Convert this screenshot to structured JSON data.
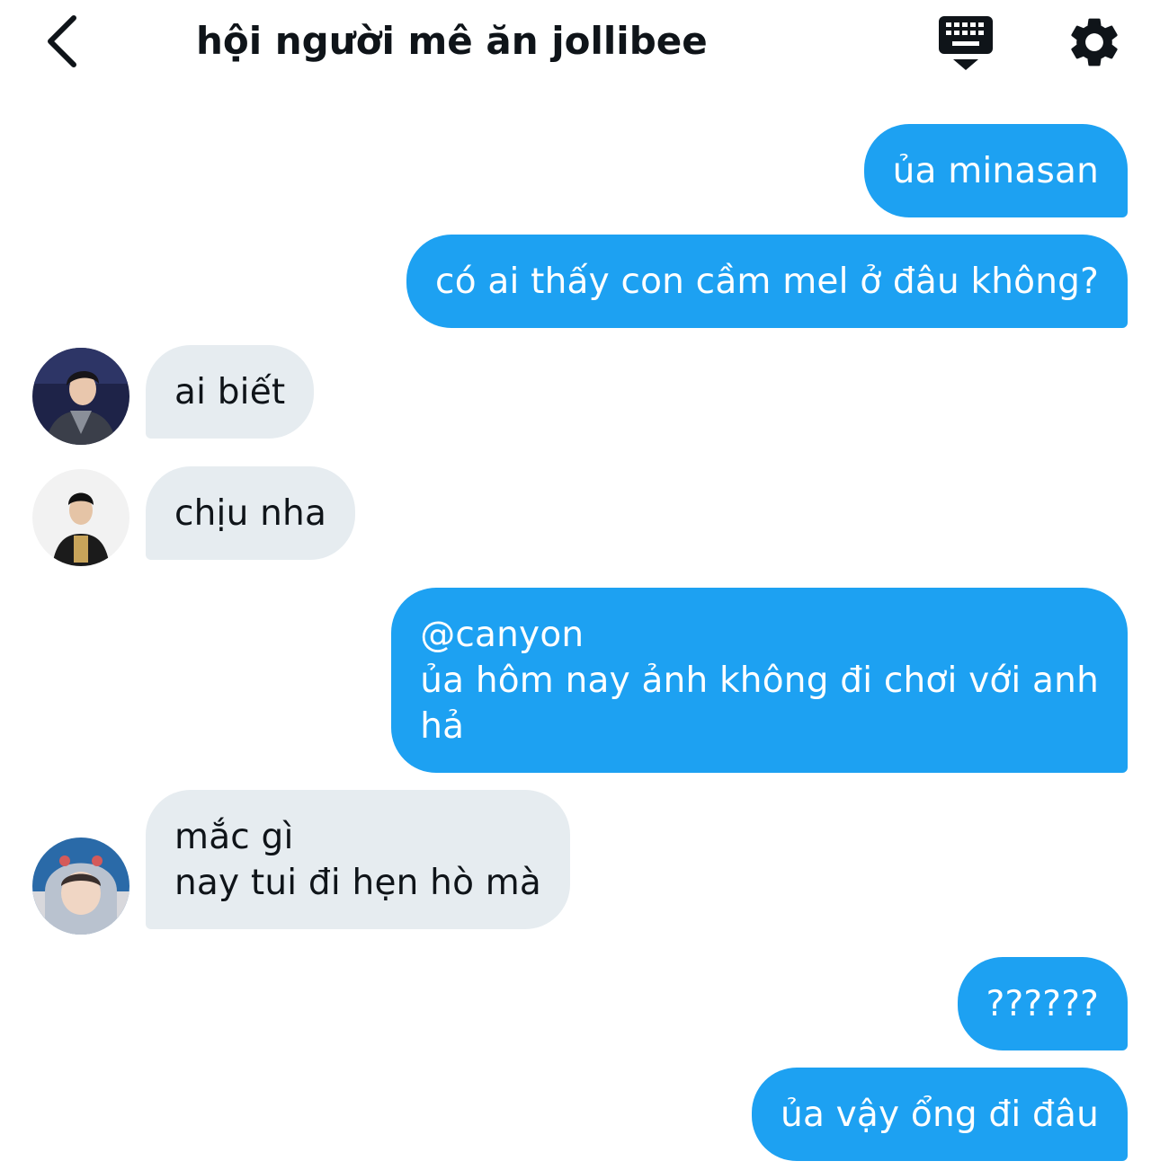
{
  "header": {
    "title": "hội người mê ăn jollibee",
    "back_icon": "chevron-left-icon",
    "keyboard_icon": "keyboard-icon",
    "settings_icon": "gear-icon"
  },
  "colors": {
    "outgoing_bubble": "#1da1f2",
    "incoming_bubble": "#e6ecf0",
    "outgoing_text": "#ffffff",
    "incoming_text": "#0f1419"
  },
  "messages": [
    {
      "direction": "outgoing",
      "text": "ủa minasan"
    },
    {
      "direction": "outgoing",
      "text": "có ai thấy con cầm mel ở đâu không?"
    },
    {
      "direction": "incoming",
      "text": "ai biết",
      "avatar": "avatar-1"
    },
    {
      "direction": "incoming",
      "text": "chịu nha",
      "avatar": "avatar-2"
    },
    {
      "direction": "outgoing",
      "text": "@canyon\nủa hôm nay ảnh không đi chơi với anh\nhả"
    },
    {
      "direction": "incoming",
      "text": "mắc gì\nnay tui đi hẹn hò mà",
      "avatar": "avatar-3"
    },
    {
      "direction": "outgoing",
      "text": "??????"
    },
    {
      "direction": "outgoing",
      "text": "ủa vậy ổng đi đâu"
    }
  ]
}
